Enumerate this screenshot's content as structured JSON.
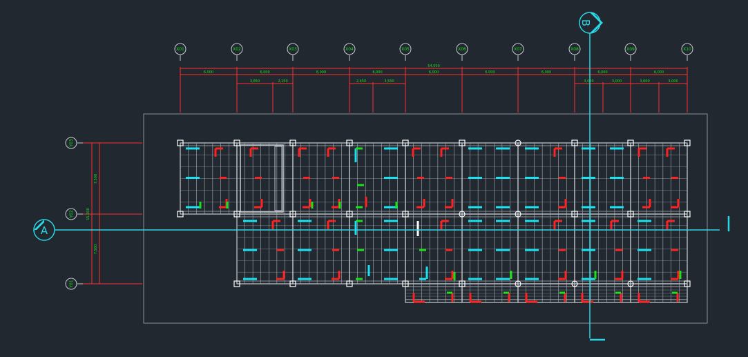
{
  "drawing": {
    "background": "#212830",
    "colors": {
      "frame": "#8a8f96",
      "dimension": "#ff3030",
      "text": "#19e019",
      "axis": "#2ad8e6",
      "grid": "#c9cdd2",
      "gridfill": "#aab0b6",
      "red": "#ff2222",
      "cyan": "#19e3f0",
      "green": "#19e019",
      "white": "#ffffff"
    },
    "x_axes": [
      "X01",
      "X02",
      "X03",
      "X04",
      "X05",
      "X06",
      "X07",
      "X08",
      "X09",
      "X10"
    ],
    "y_axes": [
      "Y03",
      "Y02",
      "Y01"
    ],
    "dim_total": "54,000",
    "dim_row1": [
      "6,000",
      "6,000",
      "6,000",
      "6,000",
      "6,000",
      "6,000",
      "6,000",
      "6,000",
      "6,000"
    ],
    "dim_row2": [
      "3,850",
      "2,150",
      "2,450",
      "3,550",
      "3,000",
      "3,000",
      "3,000",
      "3,000"
    ],
    "dim_left_segments": [
      "7,500",
      "7,500"
    ],
    "dim_left_total": "15,000",
    "section_a": "A",
    "section_b": "B"
  }
}
